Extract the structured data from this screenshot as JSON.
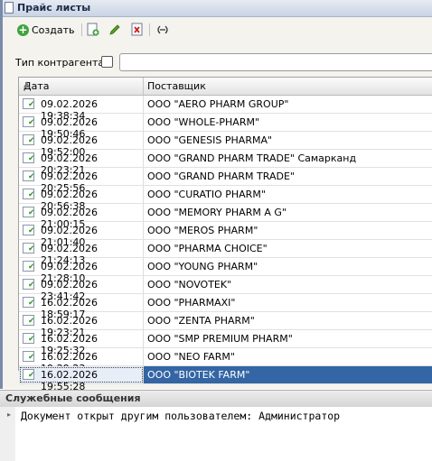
{
  "window": {
    "title": "Прайс листы"
  },
  "toolbar": {
    "create_label": "Создать"
  },
  "filter": {
    "label": "Тип контрагента:",
    "checked": false,
    "value": ""
  },
  "table": {
    "columns": [
      "Дата",
      "Поставщик"
    ],
    "rows": [
      {
        "date": "09.02.2026 19:38:34",
        "supplier": "ООО \"AERO PHARM GROUP\""
      },
      {
        "date": "09.02.2026 19:50:46",
        "supplier": "ООО \"WHOLE-PHARM\""
      },
      {
        "date": "09.02.2026 19:52:00",
        "supplier": "ООО \"GENESIS PHARMA\""
      },
      {
        "date": "09.02.2026 20:23:21",
        "supplier": "ООО \"GRAND PHARM TRADE\" Самарканд"
      },
      {
        "date": "09.02.2026 20:25:56",
        "supplier": "ООО \"GRAND PHARM TRADE\""
      },
      {
        "date": "09.02.2026 20:56:38",
        "supplier": "ООО \"CURATIO PHARM\""
      },
      {
        "date": "09.02.2026 21:00:15",
        "supplier": "ООО \"MEMORY PHARM A G\""
      },
      {
        "date": "09.02.2026 21:01:40",
        "supplier": "ООО \"MEROS PHARM\""
      },
      {
        "date": "09.02.2026 21:24:13",
        "supplier": "ООО \"PHARMA CHOICE\""
      },
      {
        "date": "09.02.2026 21:28:10",
        "supplier": "ООО \"YOUNG PHARM\""
      },
      {
        "date": "09.02.2026 23:41:42",
        "supplier": "ООО \"NOVOTEK\""
      },
      {
        "date": "16.02.2026 18:59:17",
        "supplier": "ООО \"PHARMAXI\""
      },
      {
        "date": "16.02.2026 19:23:21",
        "supplier": "ООО \"ZENTA PHARM\""
      },
      {
        "date": "16.02.2026 19:25:32",
        "supplier": "ООО \"SMP PREMIUM PHARM\""
      },
      {
        "date": "16.02.2026 19:29:23",
        "supplier": "ООО \"NEO FARM\""
      },
      {
        "date": "16.02.2026 19:55:28",
        "supplier": "ООО \"BIOTEK FARM\"",
        "selected": true
      }
    ]
  },
  "messages": {
    "title": "Служебные сообщения",
    "items": [
      "Документ открыт другим пользователем: Администратор"
    ]
  },
  "colors": {
    "selection": "#3465a4",
    "accent_check": "#2e9a2e"
  }
}
